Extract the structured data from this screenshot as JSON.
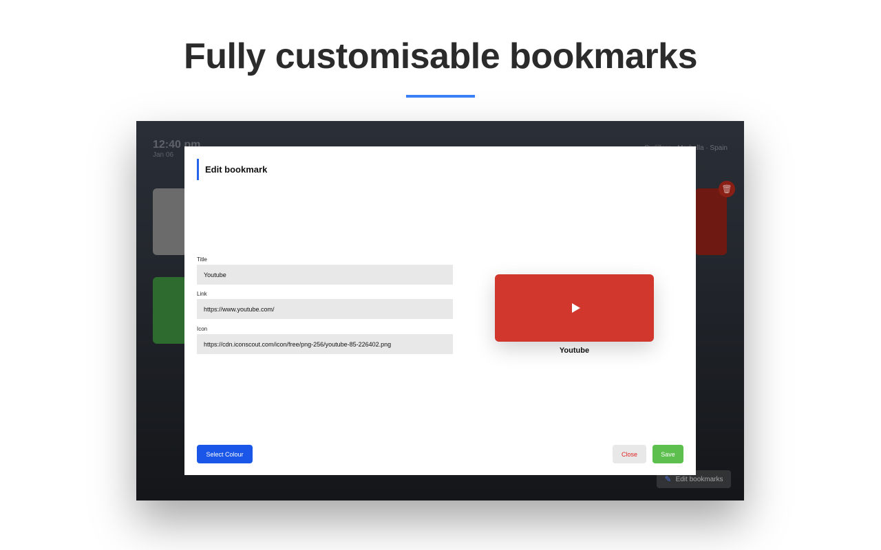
{
  "headline": "Fully customisable bookmarks",
  "background": {
    "time": "12:40 pm",
    "date": "Jan 06",
    "location": "Cudillero · Marbella · Spain",
    "edit_bookmarks_label": "Edit bookmarks",
    "delete_icon": "trash-icon",
    "edit_icon": "pencil-icon"
  },
  "modal": {
    "title": "Edit bookmark",
    "fields": {
      "title_label": "Title",
      "title_value": "Youtube",
      "link_label": "Link",
      "link_value": "https://www.youtube.com/",
      "icon_label": "Icon",
      "icon_value": "https://cdn.iconscout.com/icon/free/png-256/youtube-85-226402.png"
    },
    "preview": {
      "label": "Youtube",
      "tile_color": "#d1372c",
      "icon": "play-icon"
    },
    "buttons": {
      "select_colour": "Select Colour",
      "close": "Close",
      "save": "Save"
    }
  },
  "colors": {
    "accent": "#3b82f6",
    "primary_button": "#1a56e8",
    "save_button": "#5cbf4e",
    "close_text": "#e02424"
  }
}
